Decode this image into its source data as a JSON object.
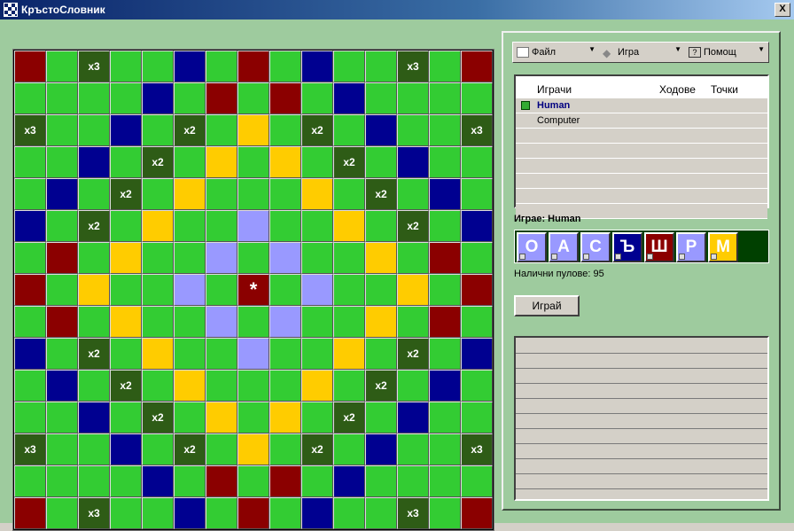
{
  "window": {
    "title": "КръстоСловник",
    "close_label": "X"
  },
  "colors": {
    "D": "#8b0000",
    "G": "#33cc33",
    "B": "#000090",
    "Y": "#ffcc00",
    "L": "#9999ff",
    "O": "#2e5c16",
    "S": "#8b0000"
  },
  "board": {
    "rows": [
      "DGOGGBGDGBGGOGD",
      "GGGGBGDGDGBGGGG",
      "OGGBGOGYGOGBGGO",
      "GGBGOGYGYGOGBGG",
      "GBGOGYGGGYGOGBG",
      "BGOGYGGLGGYGOGB",
      "GDGYGGLGLGGYGDG",
      "DGYGGLGSGLGGYGD",
      "GDGYGGLGLGGYGDG",
      "BGOGYGGLGGYGOGB",
      "GBGOGYGGGYGOGBG",
      "GGBGOGYGYGOGBGG",
      "OGGBGOGYGOGBGGO",
      "GGGGBGDGDGBGGGG",
      "DGOGGBGDGBGGOGD"
    ],
    "labels": {
      "0,2": "x3",
      "0,12": "x3",
      "2,0": "x3",
      "2,5": "x2",
      "2,9": "x2",
      "2,14": "x3",
      "3,4": "x2",
      "3,10": "x2",
      "4,3": "x2",
      "4,11": "x2",
      "5,2": "x2",
      "5,12": "x2",
      "7,7": "*",
      "9,2": "x2",
      "9,12": "x2",
      "10,3": "x2",
      "10,11": "x2",
      "11,4": "x2",
      "11,10": "x2",
      "12,0": "x3",
      "12,5": "x2",
      "12,9": "x2",
      "12,14": "x3",
      "14,2": "x3",
      "14,12": "x3"
    }
  },
  "menu": {
    "file": "Файл",
    "game": "Игра",
    "help": "Помощ"
  },
  "players_panel": {
    "headers": {
      "players": "Играчи",
      "moves": "Ходове",
      "points": "Точки"
    },
    "players": [
      {
        "name": "Human",
        "active": true
      },
      {
        "name": "Computer",
        "active": false
      }
    ]
  },
  "current_player": "Играе: Human",
  "rack": [
    {
      "letter": "О",
      "color": "#9999ff"
    },
    {
      "letter": "А",
      "color": "#9999ff"
    },
    {
      "letter": "С",
      "color": "#9999ff"
    },
    {
      "letter": "Ъ",
      "color": "#000090"
    },
    {
      "letter": "Ш",
      "color": "#8b0000"
    },
    {
      "letter": "Р",
      "color": "#9999ff"
    },
    {
      "letter": "М",
      "color": "#ffcc00"
    }
  ],
  "available_tiles": "Налични пулове: 95",
  "play_button": "Играй"
}
